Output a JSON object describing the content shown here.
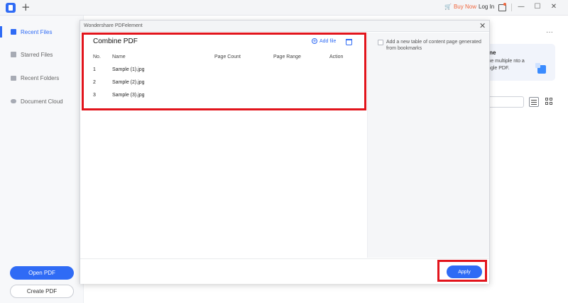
{
  "titlebar": {
    "new_tab_glyph": "+",
    "buy_now": "Buy Now",
    "login": "Log In",
    "min_glyph": "—",
    "max_glyph": "☐",
    "close_glyph": "✕"
  },
  "sidebar": {
    "items": [
      {
        "label": "Recent Files",
        "active": true
      },
      {
        "label": "Starred Files",
        "active": false
      },
      {
        "label": "Recent Folders",
        "active": false
      },
      {
        "label": "Document Cloud",
        "active": false
      }
    ],
    "open_pdf": "Open PDF",
    "create_pdf": "Create PDF"
  },
  "background": {
    "more_glyph": "···",
    "combine_title": "bine",
    "combine_desc": "bine multiple nto a single PDF."
  },
  "dialog": {
    "title": "Wondershare PDFelement",
    "close_glyph": "✕",
    "panel_title": "Combine PDF",
    "add_file": "Add file",
    "add_file_glyph": "+",
    "columns": {
      "no": "No.",
      "name": "Name",
      "page_count": "Page Count",
      "page_range": "Page Range",
      "action": "Action"
    },
    "files": [
      {
        "no": "1",
        "name": "Sample (1).jpg"
      },
      {
        "no": "2",
        "name": "Sample (2).jpg"
      },
      {
        "no": "3",
        "name": "Sample (3).jpg"
      }
    ],
    "bookmark_option": "Add a new table of content page generated from bookmarks",
    "apply": "Apply"
  },
  "colors": {
    "accent": "#2f6bf5",
    "highlight": "#e2141c",
    "buy_now": "#f0663d"
  }
}
